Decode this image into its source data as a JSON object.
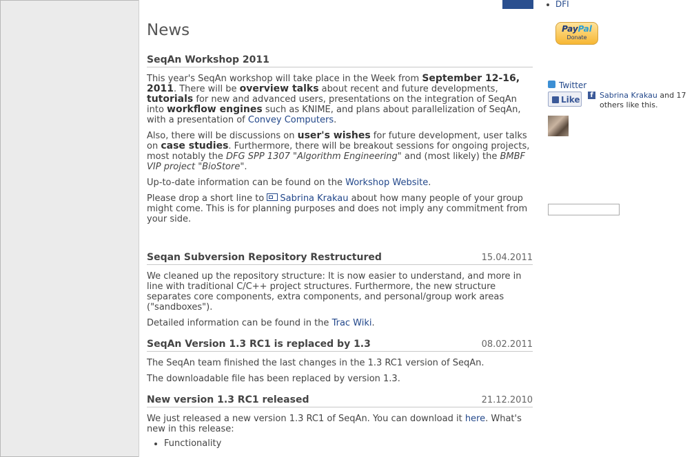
{
  "sidebar": {
    "dfi_link": "DFI",
    "paypal": {
      "brand_a": "Pay",
      "brand_b": "Pal",
      "donate": "Donate"
    },
    "twitter": "Twitter",
    "like_button": "Like",
    "fb_friend": "Sabrina Krakau",
    "fb_others": " and 17 others like this.",
    "search_value": ""
  },
  "news": {
    "heading": "News",
    "workshop": {
      "title": "SeqAn Workshop 2011",
      "p1": {
        "t1": "This year's SeqAn workshop will take place in the Week from ",
        "b1": "September 12-16, 2011",
        "t2": ". There will be ",
        "b2": "overview talks",
        "t3": " about recent and future developments, ",
        "b3": "tutorials",
        "t4": " for new and advanced users, presentations on the integration of SeqAn into ",
        "b4": "workflow engines",
        "t5": " such as KNIME, and plans about parallelization of SeqAn, with a presentation of ",
        "link": "Convey Computers",
        "t6": "."
      },
      "p2": {
        "t1": "Also, there will be discussions on ",
        "b1": "user's wishes",
        "t2": " for future development, user talks on ",
        "b2": "case studies",
        "t3": ". Furthermore, there will be breakout sessions for ongoing projects, most notably the ",
        "i1": "DFG SPP 1307 \"Algorithm Engineering\"",
        "t4": " and (most likely) the ",
        "i2": "BMBF VIP project \"BioStore\"",
        "t5": "."
      },
      "p3": {
        "t1": "Up-to-date information can be found on the ",
        "link": "Workshop Website",
        "t2": "."
      },
      "p4": {
        "t1": "Please drop a short line to ",
        "link": "Sabrina Krakau",
        "t2": " about how many people of your group might come. This is for planning purposes and does not imply any commitment from your side."
      }
    },
    "svn": {
      "title": "Seqan Subversion Repository Restructured",
      "date": "15.04.2011",
      "p1": "We cleaned up the repository structure: It is now easier to understand, and more in line with traditional C/C++ project structures. Furthermore, the new structure separates core components, extra components, and personal/group work areas (\"sandboxes\").",
      "p2": {
        "t1": "Detailed information can be found in the ",
        "link": "Trac Wiki",
        "t2": "."
      }
    },
    "v13": {
      "title": "SeqAn Version 1.3 RC1 is replaced by 1.3",
      "date": "08.02.2011",
      "p1": "The SeqAn team finished the last changes in the 1.3 RC1 version of SeqAn.",
      "p2": "The downloadable file has been replaced by version 1.3."
    },
    "rc1": {
      "title": "New version 1.3 RC1 released",
      "date": "21.12.2010",
      "p1": {
        "t1": "We just released a new version 1.3 RC1 of SeqAn. You can download it ",
        "link": "here",
        "t2": ". What's new in this release:"
      },
      "items": [
        "Functionality"
      ]
    }
  }
}
